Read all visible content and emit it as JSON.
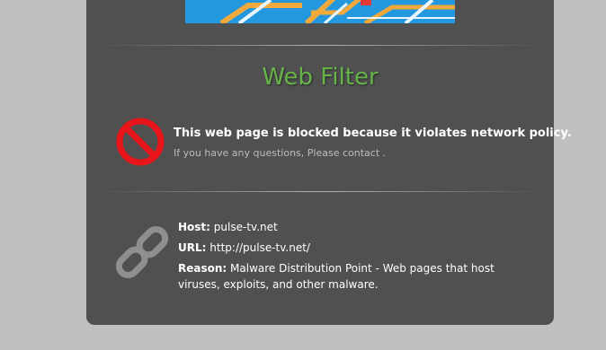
{
  "title": "Web Filter",
  "block": {
    "message": "This web page is blocked because it violates network policy.",
    "contact": "If you have any questions, Please contact ."
  },
  "details": {
    "host_label": "Host:",
    "host_value": "pulse-tv.net",
    "url_label": "URL:",
    "url_value": "http://pulse-tv.net/",
    "reason_label": "Reason:",
    "reason_value": "Malware Distribution Point - Web pages that host viruses, exploits, and other malware."
  },
  "icons": {
    "block": "prohibited-icon",
    "link": "chain-link-icon"
  },
  "colors": {
    "page_background": "#bfbfbf",
    "panel_background": "#505050",
    "title_green": "#66b34a",
    "block_red": "#e8151b",
    "chain_gray": "#8f8f8f",
    "banner_blue": "#1f8fd8",
    "banner_orange": "#f2a93b"
  }
}
